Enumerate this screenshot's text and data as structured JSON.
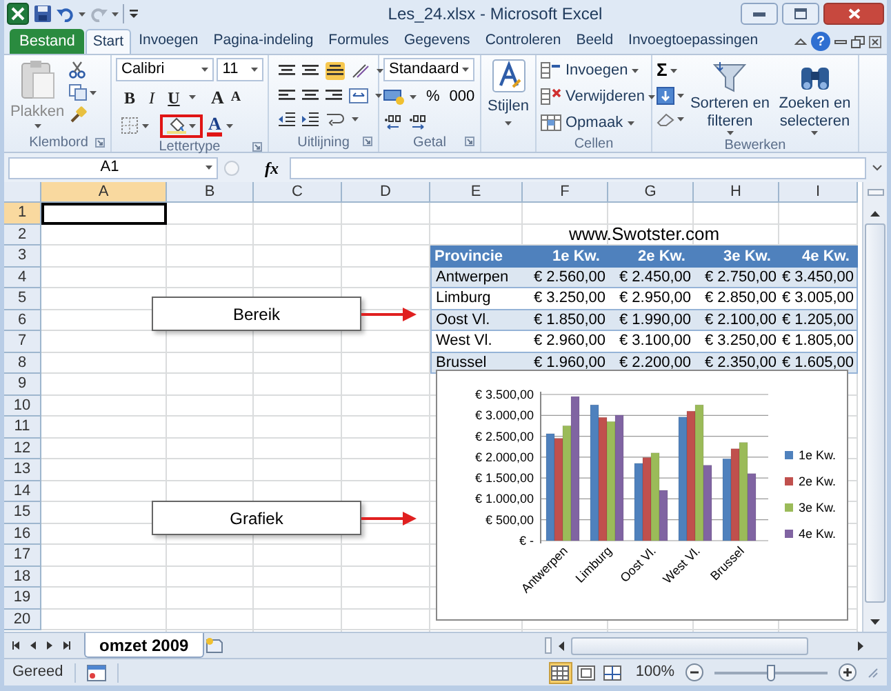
{
  "window": {
    "title": "Les_24.xlsx - Microsoft Excel"
  },
  "ribbon_tabs": [
    {
      "label": "Bestand",
      "kind": "file",
      "selected": false
    },
    {
      "label": "Start",
      "kind": "tab",
      "selected": true
    },
    {
      "label": "Invoegen",
      "kind": "tab",
      "selected": false
    },
    {
      "label": "Pagina-indeling",
      "kind": "tab",
      "selected": false
    },
    {
      "label": "Formules",
      "kind": "tab",
      "selected": false
    },
    {
      "label": "Gegevens",
      "kind": "tab",
      "selected": false
    },
    {
      "label": "Controleren",
      "kind": "tab",
      "selected": false
    },
    {
      "label": "Beeld",
      "kind": "tab",
      "selected": false
    },
    {
      "label": "Invoegtoepassingen",
      "kind": "tab",
      "selected": false
    }
  ],
  "help": "?",
  "clipboard": {
    "paste": "Plakken",
    "label": "Klembord"
  },
  "font": {
    "name": "Calibri",
    "size": "11",
    "bold": "B",
    "italic": "I",
    "underline": "U",
    "grow": "A",
    "shrink": "A",
    "color_button": "A",
    "fill_highlighted": true,
    "label": "Lettertype"
  },
  "alignment": {
    "label": "Uitlijning"
  },
  "number": {
    "format": "Standaard",
    "percent": "%",
    "thousands": "000",
    "label": "Getal"
  },
  "styles": {
    "button": "Stijlen"
  },
  "cells": {
    "items": [
      "Invoegen",
      "Verwijderen",
      "Opmaak"
    ],
    "label": "Cellen"
  },
  "editing": {
    "sum": "Σ",
    "sort": "Sorteren en filteren",
    "find": "Zoeken en selecteren",
    "label": "Bewerken"
  },
  "formula_bar": {
    "name_box": "A1",
    "fx": "fx"
  },
  "sheet": {
    "columns": [
      {
        "label": "A",
        "selected": true
      },
      {
        "label": "B",
        "selected": false
      },
      {
        "label": "C",
        "selected": false
      },
      {
        "label": "D",
        "selected": false
      },
      {
        "label": "E",
        "selected": false
      },
      {
        "label": "F",
        "selected": false
      },
      {
        "label": "G",
        "selected": false
      },
      {
        "label": "H",
        "selected": false
      },
      {
        "label": "I",
        "selected": false
      }
    ],
    "rows": [
      {
        "label": "1",
        "selected": true
      },
      {
        "label": "2",
        "selected": false
      },
      {
        "label": "3",
        "selected": false
      },
      {
        "label": "4",
        "selected": false
      },
      {
        "label": "5",
        "selected": false
      },
      {
        "label": "6",
        "selected": false
      },
      {
        "label": "7",
        "selected": false
      },
      {
        "label": "8",
        "selected": false
      },
      {
        "label": "9",
        "selected": false
      },
      {
        "label": "10",
        "selected": false
      },
      {
        "label": "11",
        "selected": false
      },
      {
        "label": "12",
        "selected": false
      },
      {
        "label": "13",
        "selected": false
      },
      {
        "label": "14",
        "selected": false
      },
      {
        "label": "15",
        "selected": false
      },
      {
        "label": "16",
        "selected": false
      },
      {
        "label": "17",
        "selected": false
      },
      {
        "label": "18",
        "selected": false
      },
      {
        "label": "19",
        "selected": false
      },
      {
        "label": "20",
        "selected": false
      }
    ],
    "title": "www.Swotster.com",
    "table": {
      "columns": [
        "Provincie",
        "1e Kw.",
        "2e Kw.",
        "3e Kw.",
        "4e Kw."
      ],
      "rows": [
        [
          "Antwerpen",
          "€ 2.560,00",
          "€ 2.450,00",
          "€ 2.750,00",
          "€ 3.450,00"
        ],
        [
          "Limburg",
          "€ 3.250,00",
          "€ 2.950,00",
          "€ 2.850,00",
          "€ 3.005,00"
        ],
        [
          "Oost Vl.",
          "€ 1.850,00",
          "€ 1.990,00",
          "€ 2.100,00",
          "€ 1.205,00"
        ],
        [
          "West Vl.",
          "€ 2.960,00",
          "€ 3.100,00",
          "€ 3.250,00",
          "€ 1.805,00"
        ],
        [
          "Brussel",
          "€ 1.960,00",
          "€ 2.200,00",
          "€ 2.350,00",
          "€ 1.605,00"
        ]
      ]
    }
  },
  "callouts": [
    "Bereik",
    "Grafiek"
  ],
  "chart": {
    "chart_data": {
      "type": "bar",
      "categories": [
        "Antwerpen",
        "Limburg",
        "Oost Vl.",
        "West Vl.",
        "Brussel"
      ],
      "series": [
        {
          "name": "1e Kw.",
          "color": "#4f81bd",
          "values": [
            2560,
            3250,
            1850,
            2960,
            1960
          ]
        },
        {
          "name": "2e Kw.",
          "color": "#c0504d",
          "values": [
            2450,
            2950,
            1990,
            3100,
            2200
          ]
        },
        {
          "name": "3e Kw.",
          "color": "#9bbb59",
          "values": [
            2750,
            2850,
            2100,
            3250,
            2350
          ]
        },
        {
          "name": "4e Kw.",
          "color": "#8064a2",
          "values": [
            3450,
            3005,
            1205,
            1805,
            1605
          ]
        }
      ],
      "ylim": [
        0,
        3500
      ],
      "grid": true,
      "legend": "right",
      "yticks": [
        {
          "value": 0,
          "label": "€ -"
        },
        {
          "value": 500,
          "label": "€ 500,00"
        },
        {
          "value": 1000,
          "label": "€ 1.000,00"
        },
        {
          "value": 1500,
          "label": "€ 1.500,00"
        },
        {
          "value": 2000,
          "label": "€ 2.000,00"
        },
        {
          "value": 2500,
          "label": "€ 2.500,00"
        },
        {
          "value": 3000,
          "label": "€ 3.000,00"
        },
        {
          "value": 3500,
          "label": "€ 3.500,00"
        }
      ]
    }
  },
  "sheet_tabs": [
    {
      "label": "omzet 2009",
      "selected": true
    }
  ],
  "status_bar": {
    "text": "Gereed",
    "views": [
      {
        "selected": true
      },
      {
        "selected": false
      },
      {
        "selected": false
      }
    ],
    "zoom": "100%",
    "zoom_slider": {
      "level": 0.5
    }
  }
}
